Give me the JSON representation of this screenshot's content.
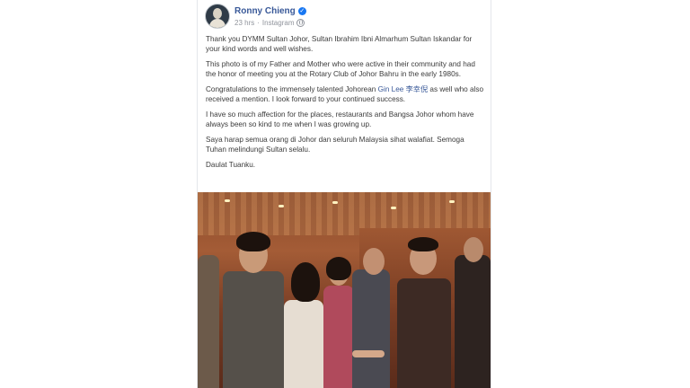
{
  "post": {
    "author": "Ronny Chieng",
    "time": "23 hrs",
    "source": "Instagram",
    "paragraphs": [
      [
        "Thank you DYMM Sultan Johor, Sultan Ibrahim Ibni Almarhum Sultan Iskandar for your kind words and well wishes."
      ],
      [
        "This photo is of my Father and Mother who were active in their community and had the honor of meeting you at the Rotary Club of Johor Bahru in the early 1980s."
      ],
      [
        "Congratulations to the immensely talented Johorean ",
        "Gin Lee 李幸倪",
        " as well who also received a mention. I look forward to your continued success."
      ],
      [
        "I have so much affection for the places, restaurants and Bangsa Johor whom have always been so kind to me when I was growing up."
      ],
      [
        "Saya harap semua orang di Johor dan seluruh Malaysia sihat walafiat. Semoga Tuhan melindungi Sultan selalu."
      ],
      [
        "Daulat Tuanku."
      ]
    ]
  },
  "icons": {
    "verified": "verified-badge-icon",
    "privacy": "globe-icon"
  },
  "colors": {
    "author_link": "#385898",
    "meta": "#90949c",
    "verified": "#1877f2"
  }
}
